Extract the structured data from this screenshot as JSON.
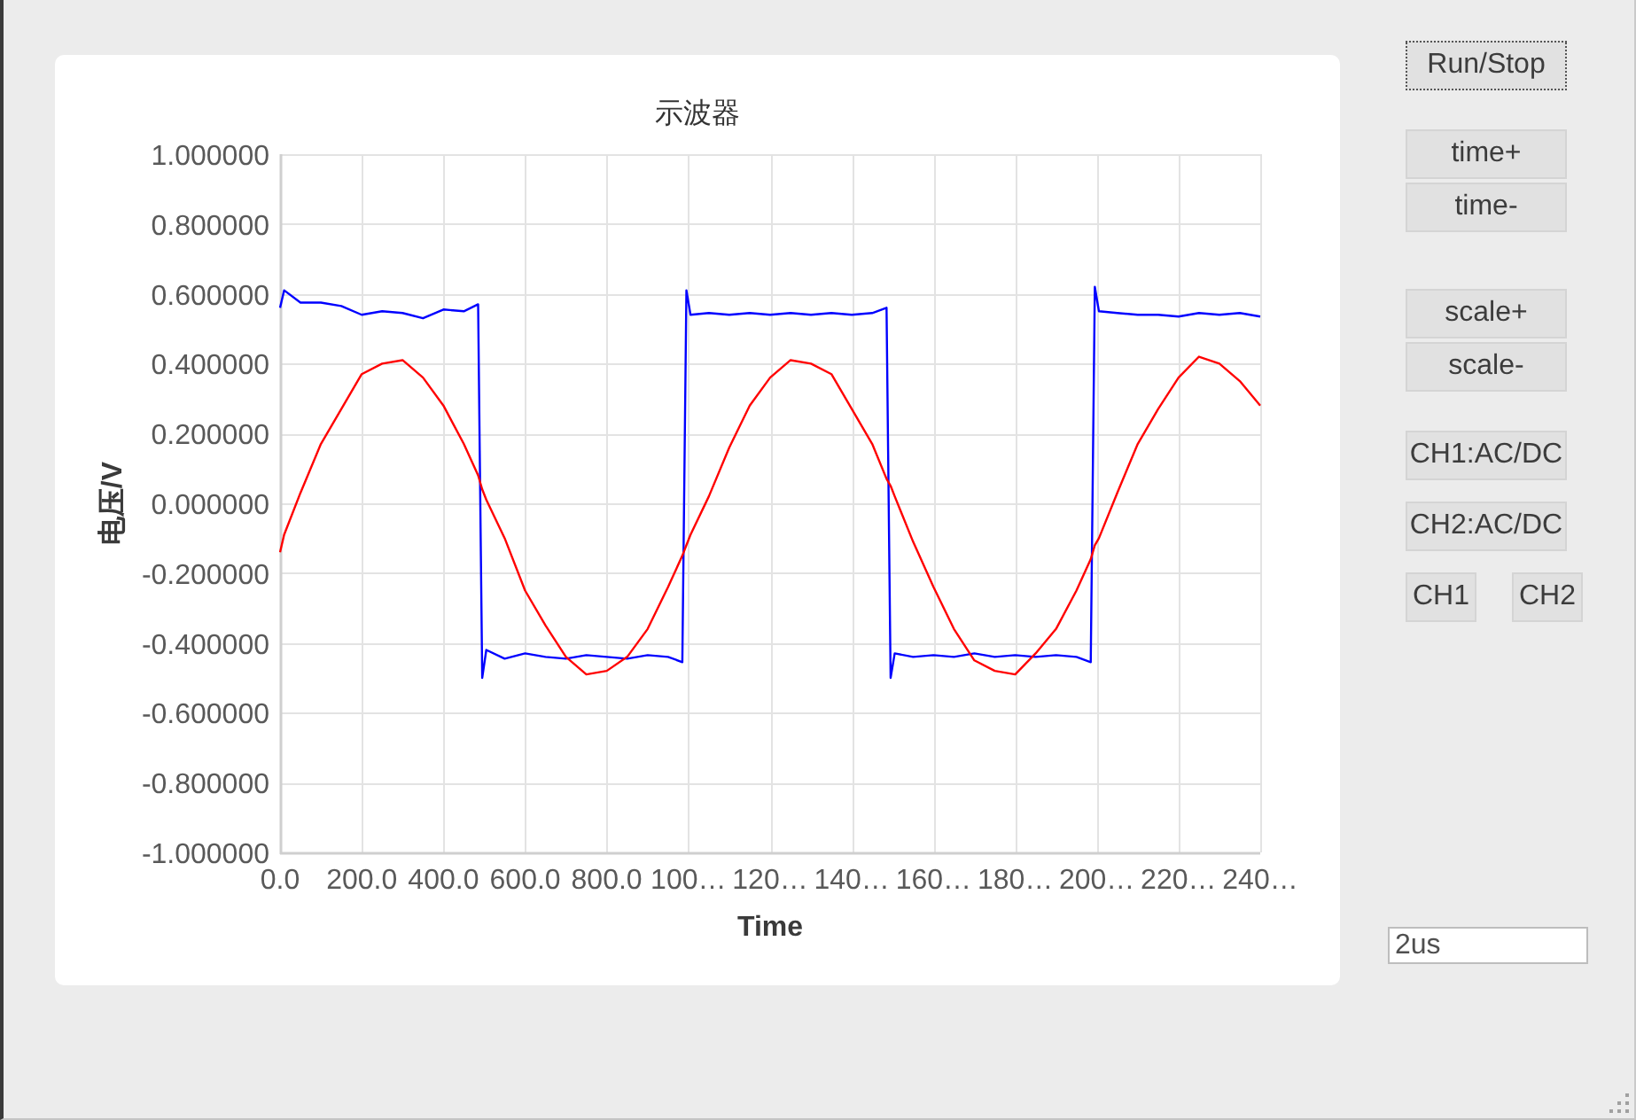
{
  "chart": {
    "chart_data": {
      "type": "line",
      "title": "示波器",
      "xlabel": "Time",
      "ylabel": "电压/V",
      "grid": true,
      "x": [
        0,
        10,
        50,
        100,
        150,
        200,
        250,
        300,
        350,
        400,
        450,
        485,
        495,
        505,
        550,
        600,
        650,
        700,
        750,
        800,
        850,
        900,
        950,
        985,
        995,
        1005,
        1050,
        1100,
        1150,
        1200,
        1250,
        1300,
        1350,
        1400,
        1450,
        1485,
        1495,
        1505,
        1550,
        1600,
        1650,
        1700,
        1750,
        1800,
        1850,
        1900,
        1950,
        1985,
        1995,
        2005,
        2050,
        2100,
        2150,
        2200,
        2250,
        2300,
        2350,
        2400
      ],
      "series": [
        {
          "color": "#0000ff",
          "values": [
            0.56,
            0.61,
            0.575,
            0.575,
            0.565,
            0.54,
            0.55,
            0.545,
            0.53,
            0.555,
            0.55,
            0.57,
            -0.5,
            -0.42,
            -0.445,
            -0.43,
            -0.44,
            -0.445,
            -0.435,
            -0.44,
            -0.445,
            -0.435,
            -0.44,
            -0.455,
            0.61,
            0.54,
            0.545,
            0.54,
            0.545,
            0.54,
            0.545,
            0.54,
            0.545,
            0.54,
            0.545,
            0.56,
            -0.5,
            -0.43,
            -0.44,
            -0.435,
            -0.44,
            -0.43,
            -0.44,
            -0.435,
            -0.44,
            -0.435,
            -0.44,
            -0.455,
            0.62,
            0.55,
            0.545,
            0.54,
            0.54,
            0.535,
            0.545,
            0.54,
            0.545,
            0.535
          ]
        },
        {
          "color": "#ff0000",
          "values": [
            -0.14,
            -0.09,
            0.03,
            0.17,
            0.27,
            0.37,
            0.4,
            0.41,
            0.36,
            0.28,
            0.17,
            0.08,
            0.04,
            0.01,
            -0.1,
            -0.25,
            -0.35,
            -0.44,
            -0.49,
            -0.48,
            -0.44,
            -0.36,
            -0.24,
            -0.15,
            -0.12,
            -0.09,
            0.02,
            0.16,
            0.28,
            0.36,
            0.41,
            0.4,
            0.37,
            0.27,
            0.17,
            0.07,
            0.05,
            0.02,
            -0.11,
            -0.24,
            -0.36,
            -0.45,
            -0.48,
            -0.49,
            -0.43,
            -0.36,
            -0.25,
            -0.16,
            -0.12,
            -0.1,
            0.03,
            0.17,
            0.27,
            0.36,
            0.42,
            0.4,
            0.35,
            0.28
          ]
        }
      ],
      "xlim": [
        0,
        2400
      ],
      "ylim": [
        -1,
        1
      ],
      "xticks": [
        {
          "value": 0,
          "label": "0.0"
        },
        {
          "value": 200,
          "label": "200.0"
        },
        {
          "value": 400,
          "label": "400.0"
        },
        {
          "value": 600,
          "label": "600.0"
        },
        {
          "value": 800,
          "label": "800.0"
        },
        {
          "value": 1000,
          "label": "100…"
        },
        {
          "value": 1200,
          "label": "120…"
        },
        {
          "value": 1400,
          "label": "140…"
        },
        {
          "value": 1600,
          "label": "160…"
        },
        {
          "value": 1800,
          "label": "180…"
        },
        {
          "value": 2000,
          "label": "200…"
        },
        {
          "value": 2200,
          "label": "220…"
        },
        {
          "value": 2400,
          "label": "240…"
        }
      ],
      "yticks": [
        {
          "value": 1,
          "label": "1.000000"
        },
        {
          "value": 0.8,
          "label": "0.800000"
        },
        {
          "value": 0.6,
          "label": "0.600000"
        },
        {
          "value": 0.4,
          "label": "0.400000"
        },
        {
          "value": 0.2,
          "label": "0.200000"
        },
        {
          "value": 0,
          "label": "0.000000"
        },
        {
          "value": -0.2,
          "label": "-0.200000"
        },
        {
          "value": -0.4,
          "label": "-0.400000"
        },
        {
          "value": -0.6,
          "label": "-0.600000"
        },
        {
          "value": -0.8,
          "label": "-0.800000"
        },
        {
          "value": -1,
          "label": "-1.000000"
        }
      ]
    }
  },
  "controls": {
    "button_rows": [
      [
        {
          "label": "Run/Stop",
          "focused": true
        }
      ],
      [
        {
          "label": "time+",
          "focused": false
        }
      ],
      [
        {
          "label": "time-",
          "focused": false
        }
      ],
      [
        {
          "label": "scale+",
          "focused": false
        }
      ],
      [
        {
          "label": "scale-",
          "focused": false
        }
      ],
      [
        {
          "label": "CH1:AC/DC",
          "focused": false
        }
      ],
      [
        {
          "label": "CH2:AC/DC",
          "focused": false
        }
      ],
      [
        {
          "label": "CH1",
          "focused": false
        },
        {
          "label": "CH2",
          "focused": false
        }
      ]
    ],
    "time_field": {
      "value": "2us"
    }
  }
}
